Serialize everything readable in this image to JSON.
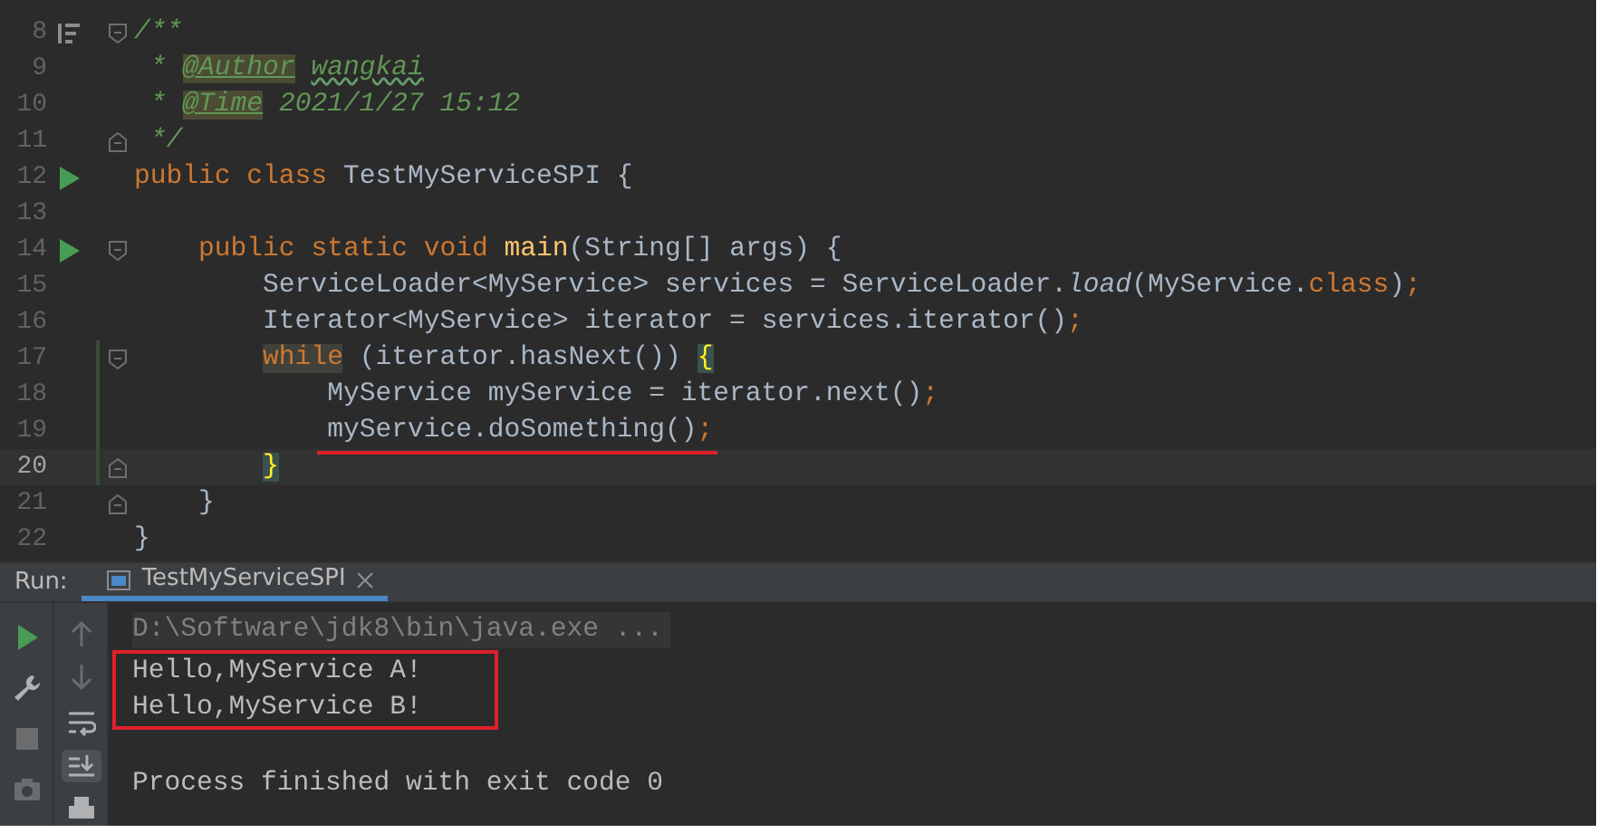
{
  "editor": {
    "lines": [
      {
        "number": "8",
        "gutter_icon": {
          "kind": "doc"
        },
        "fold_marker": {
          "kind": "start"
        },
        "changed": false,
        "current": false,
        "marked": false,
        "tokens": [
          {
            "text": "/**",
            "kind": "comment"
          }
        ]
      },
      {
        "number": "9",
        "changed": false,
        "current": false,
        "marked": false,
        "tokens": [
          {
            "text": " * ",
            "kind": "comment"
          },
          {
            "text": "@Author",
            "kind": "tag"
          },
          {
            "text": " wangkai",
            "kind": "typo"
          }
        ]
      },
      {
        "number": "10",
        "changed": false,
        "current": false,
        "marked": false,
        "tokens": [
          {
            "text": " * ",
            "kind": "comment"
          },
          {
            "text": "@Time",
            "kind": "tag"
          },
          {
            "text": " 2021/1/27 15:12",
            "kind": "comment"
          }
        ]
      },
      {
        "number": "11",
        "fold_marker": {
          "kind": "end"
        },
        "changed": false,
        "current": false,
        "marked": false,
        "tokens": [
          {
            "text": " */",
            "kind": "comment"
          }
        ]
      },
      {
        "number": "12",
        "gutter_icon": {
          "kind": "run"
        },
        "changed": false,
        "current": false,
        "marked": false,
        "tokens": [
          {
            "text": "public class ",
            "kind": "keyword"
          },
          {
            "text": "TestMyServiceSPI {",
            "kind": "plain"
          }
        ]
      },
      {
        "number": "13",
        "changed": false,
        "current": false,
        "marked": false
      },
      {
        "number": "14",
        "gutter_icon": {
          "kind": "run"
        },
        "fold_marker": {
          "kind": "start"
        },
        "changed": false,
        "current": false,
        "marked": false,
        "tokens": [
          {
            "text": "    public static void ",
            "kind": "keyword"
          },
          {
            "text": "main",
            "kind": "decl"
          },
          {
            "text": "(String[] args) {",
            "kind": "plain"
          }
        ]
      },
      {
        "number": "15",
        "changed": false,
        "current": false,
        "marked": false,
        "tokens": [
          {
            "text": "        ServiceLoader<MyService> services = ServiceLoader.",
            "kind": "plain"
          },
          {
            "text": "load",
            "kind": "static"
          },
          {
            "text": "(MyService.",
            "kind": "plain"
          },
          {
            "text": "class",
            "kind": "keyword"
          },
          {
            "text": ")",
            "kind": "plain"
          },
          {
            "text": ";",
            "kind": "keyword"
          }
        ]
      },
      {
        "number": "16",
        "changed": false,
        "current": false,
        "marked": false,
        "tokens": [
          {
            "text": "        Iterator<MyService> iterator = services.iterator()",
            "kind": "plain"
          },
          {
            "text": ";",
            "kind": "keyword"
          }
        ]
      },
      {
        "number": "17",
        "fold_marker": {
          "kind": "start"
        },
        "changed": true,
        "current": false,
        "marked": false,
        "tokens": [
          {
            "text": "        while",
            "kind": "keyword-highlight"
          },
          {
            "text": " (iterator.hasNext()) ",
            "kind": "plain"
          },
          {
            "text": "{",
            "kind": "brace-match"
          }
        ]
      },
      {
        "number": "18",
        "changed": true,
        "current": false,
        "marked": false,
        "tokens": [
          {
            "text": "            MyService myService = iterator.next()",
            "kind": "plain"
          },
          {
            "text": ";",
            "kind": "keyword"
          }
        ]
      },
      {
        "number": "19",
        "changed": true,
        "current": false,
        "marked": true,
        "tokens": [
          {
            "text": "            myService.doSomething()",
            "kind": "plain"
          },
          {
            "text": ";",
            "kind": "keyword"
          }
        ]
      },
      {
        "number": "20",
        "fold_marker": {
          "kind": "end"
        },
        "changed": true,
        "current": true,
        "marked": false,
        "tokens": [
          {
            "text": "        }",
            "kind": "brace-match"
          }
        ]
      },
      {
        "number": "21",
        "fold_marker": {
          "kind": "end"
        },
        "changed": false,
        "current": false,
        "marked": false,
        "tokens": [
          {
            "text": "    }",
            "kind": "plain"
          }
        ]
      },
      {
        "number": "22",
        "changed": false,
        "current": false,
        "marked": false,
        "tokens": [
          {
            "text": "}",
            "kind": "plain"
          }
        ]
      }
    ]
  },
  "run_panel": {
    "label": "Run:",
    "tabs": [
      {
        "title": "TestMyServiceSPI",
        "selected": true
      }
    ],
    "tools_left": [
      {
        "kind": "rerun",
        "disabled": false
      },
      {
        "kind": "wrench",
        "disabled": false
      },
      {
        "kind": "stop",
        "disabled": true
      },
      {
        "kind": "camera",
        "disabled": true
      }
    ],
    "tools_right": [
      {
        "kind": "up",
        "disabled": true,
        "selected": false
      },
      {
        "kind": "down",
        "disabled": true,
        "selected": false
      },
      {
        "kind": "wrap",
        "disabled": false,
        "selected": false
      },
      {
        "kind": "scroll-end",
        "disabled": false,
        "selected": true
      },
      {
        "kind": "print",
        "disabled": false,
        "selected": false
      }
    ],
    "console": [
      {
        "text": "D:\\Software\\jdk8\\bin\\java.exe ...",
        "kind": "command",
        "boxed": false
      },
      {
        "text": "Hello,MyService A!",
        "kind": "output",
        "boxed": true
      },
      {
        "text": "Hello,MyService B!",
        "kind": "output",
        "boxed": true
      },
      {
        "kind": "blank",
        "boxed": false
      },
      {
        "text": "Process finished with exit code 0",
        "kind": "output",
        "boxed": false
      }
    ]
  }
}
